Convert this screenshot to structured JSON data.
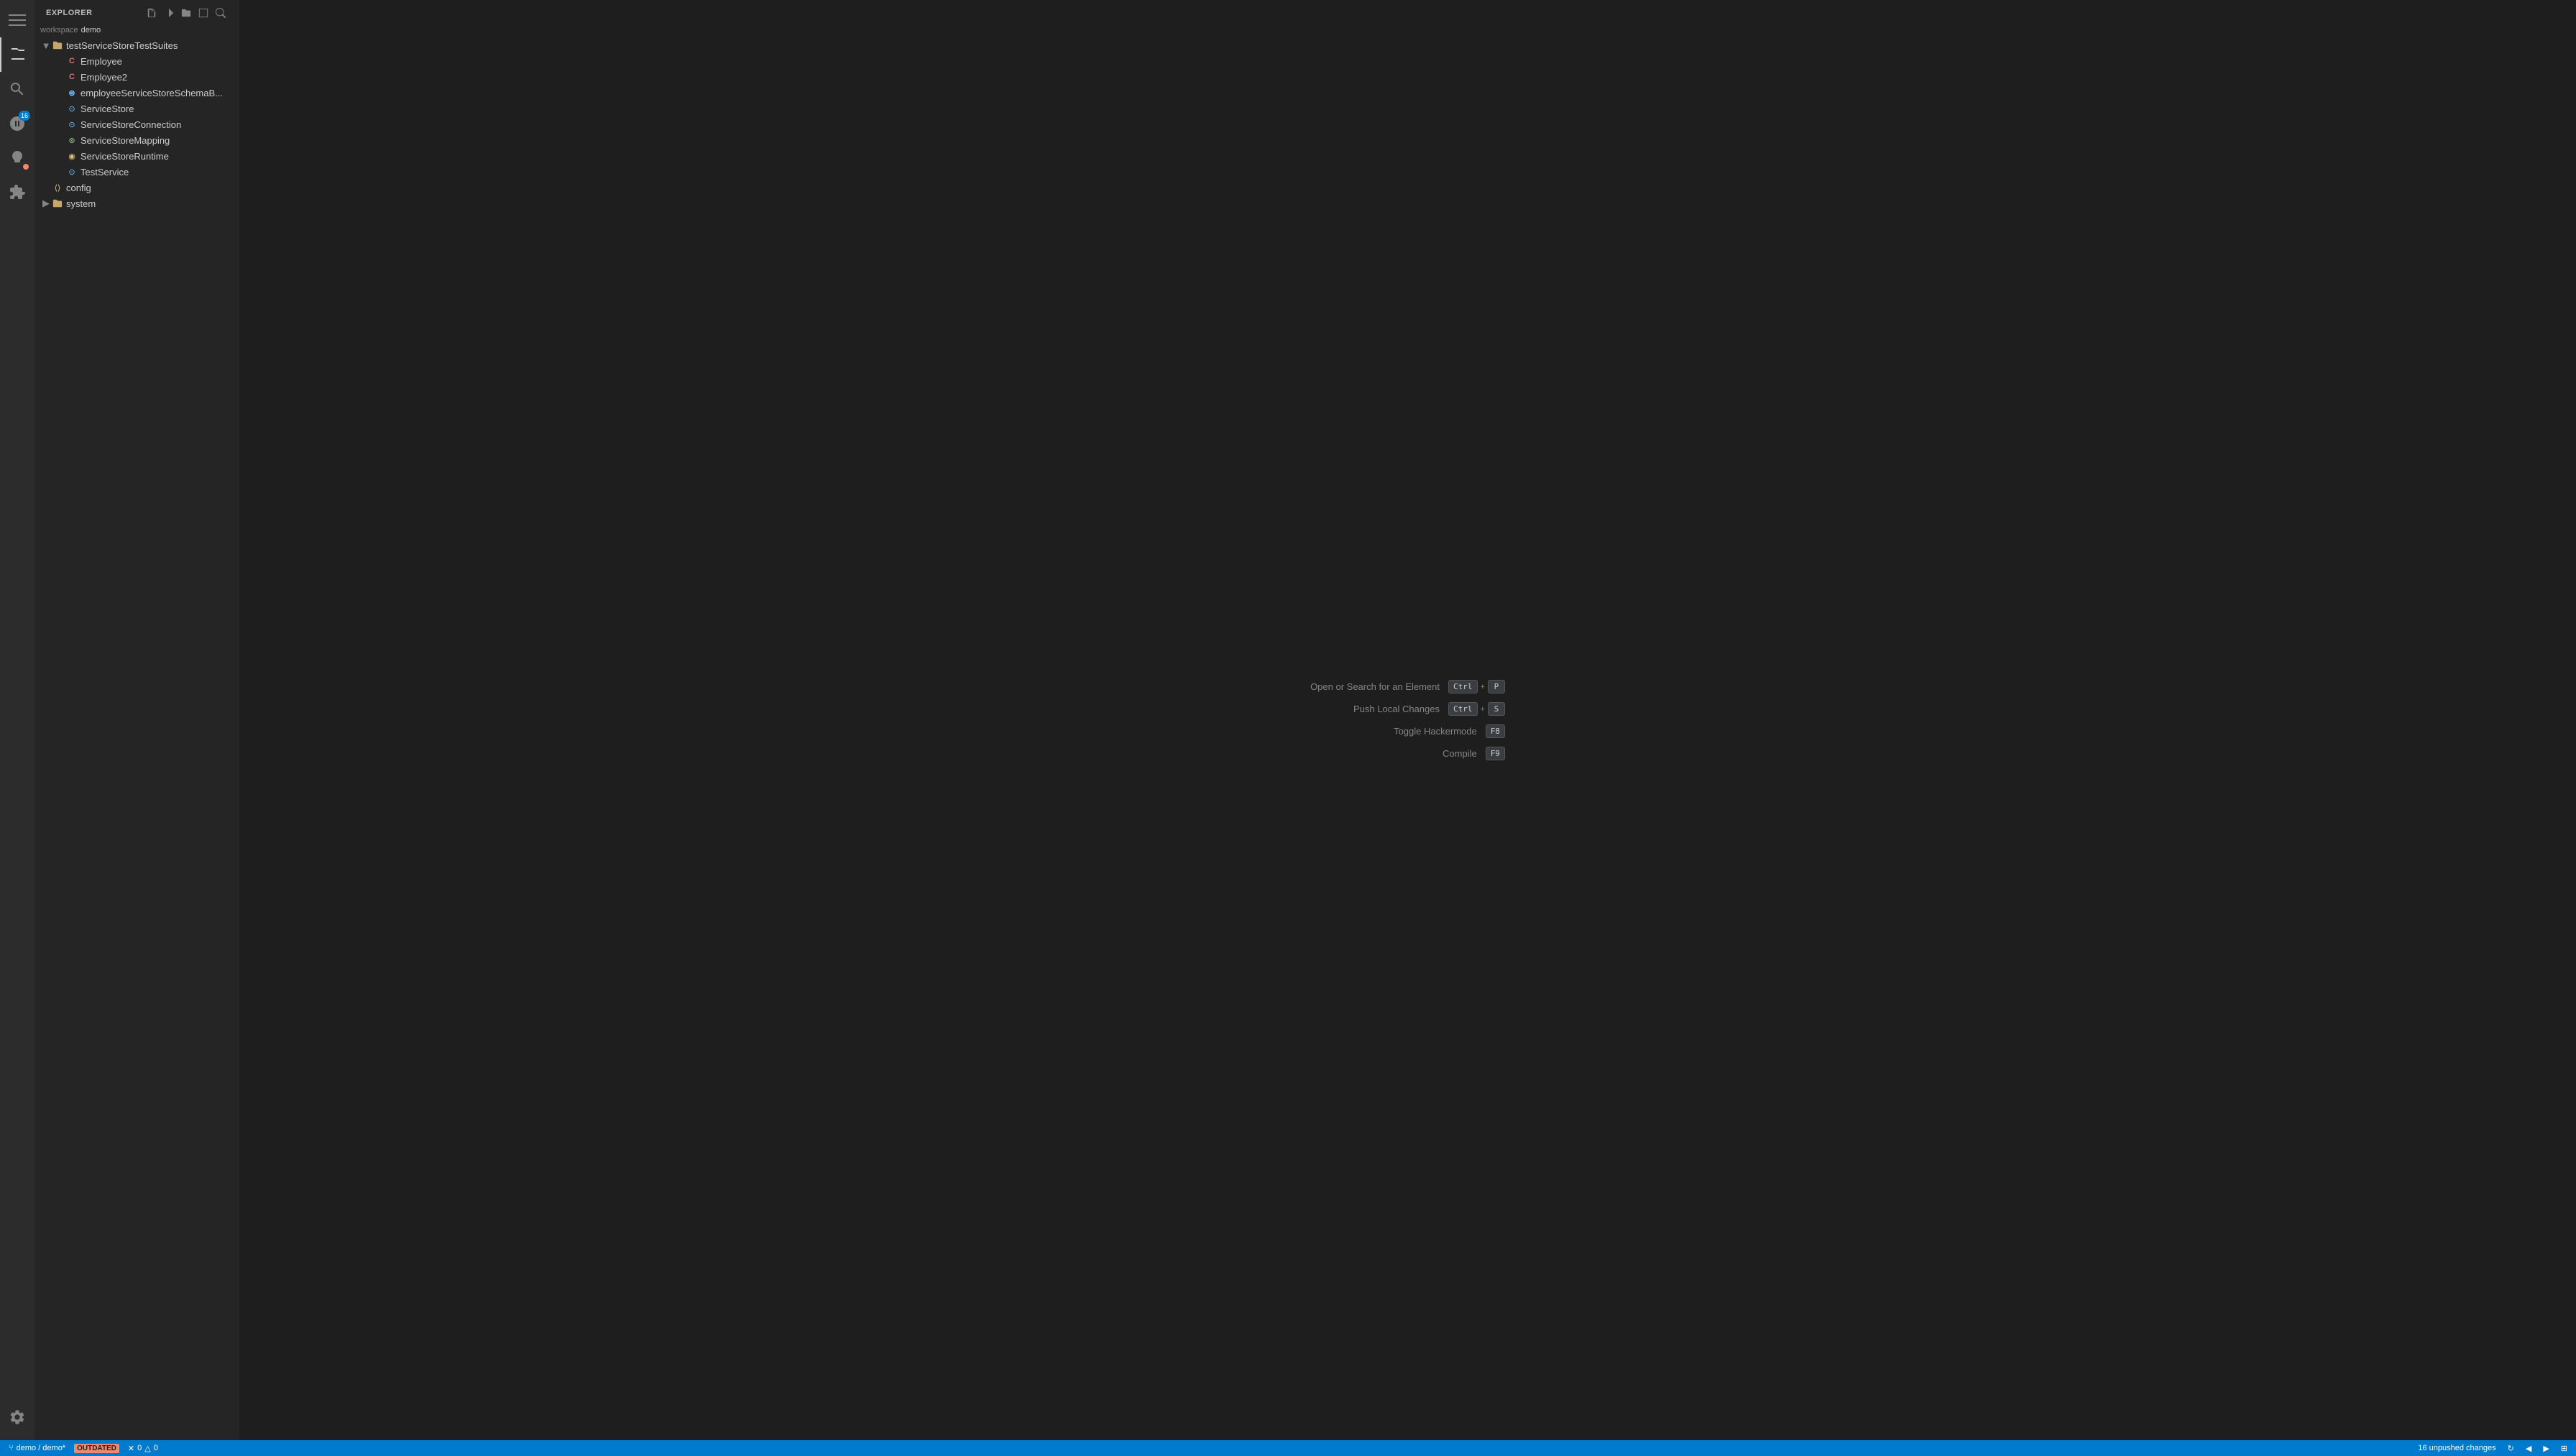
{
  "activityBar": {
    "items": [
      {
        "name": "menu-icon",
        "icon": "≡",
        "active": false
      },
      {
        "name": "explorer-icon",
        "icon": "📄",
        "active": true
      },
      {
        "name": "search-icon",
        "icon": "🔍",
        "active": false
      },
      {
        "name": "git-icon",
        "icon": "⑂",
        "active": false,
        "badge": "16"
      },
      {
        "name": "debug-icon",
        "icon": "▶",
        "active": false,
        "badge_red": true
      },
      {
        "name": "extensions-icon",
        "icon": "⊞",
        "active": false
      },
      {
        "name": "tools-icon",
        "icon": "🔧",
        "active": false
      }
    ]
  },
  "sidebar": {
    "title": "EXPLORER",
    "workspace_label": "workspace",
    "workspace_name": "demo",
    "tree": [
      {
        "id": "testServiceStoreTestSuites",
        "label": "testServiceStoreTestSuites",
        "type": "folder-open",
        "indent": 0,
        "expanded": true
      },
      {
        "id": "Employee",
        "label": "Employee",
        "type": "class",
        "indent": 1
      },
      {
        "id": "Employee2",
        "label": "Employee2",
        "type": "class",
        "indent": 1
      },
      {
        "id": "employeeServiceStoreSchemaBinding",
        "label": "employeeServiceStoreSchemaB...",
        "type": "interface",
        "indent": 1
      },
      {
        "id": "ServiceStore",
        "label": "ServiceStore",
        "type": "service",
        "indent": 1
      },
      {
        "id": "ServiceStoreConnection",
        "label": "ServiceStoreConnection",
        "type": "interface",
        "indent": 1
      },
      {
        "id": "ServiceStoreMapping",
        "label": "ServiceStoreMapping",
        "type": "mapping",
        "indent": 1
      },
      {
        "id": "ServiceStoreRuntime",
        "label": "ServiceStoreRuntime",
        "type": "runtime",
        "indent": 1
      },
      {
        "id": "TestService",
        "label": "TestService",
        "type": "service",
        "indent": 1
      },
      {
        "id": "config",
        "label": "config",
        "type": "config",
        "indent": 0
      },
      {
        "id": "system",
        "label": "system",
        "type": "folder",
        "indent": 0,
        "expanded": false
      }
    ]
  },
  "main": {
    "shortcuts": [
      {
        "label": "Open or Search for an Element",
        "keys": [
          "Ctrl",
          "+",
          "P"
        ]
      },
      {
        "label": "Push Local Changes",
        "keys": [
          "Ctrl",
          "+",
          "S"
        ]
      },
      {
        "label": "Toggle Hackermode",
        "keys": [
          "F8"
        ]
      },
      {
        "label": "Compile",
        "keys": [
          "F9"
        ]
      }
    ]
  },
  "statusBar": {
    "branch": "demo / demo*",
    "outdated": "OUTDATED",
    "errors": "0",
    "warnings": "0",
    "unpushed": "16 unpushed changes"
  }
}
